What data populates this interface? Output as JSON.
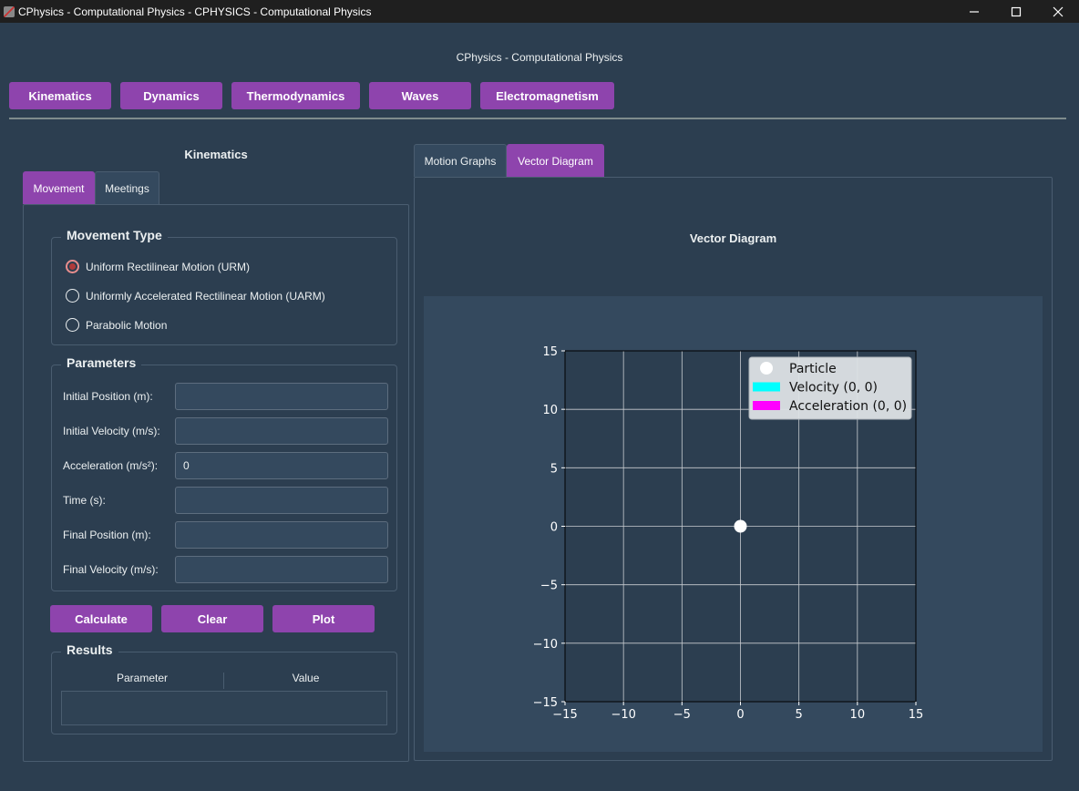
{
  "window": {
    "title": "CPhysics - Computational Physics - CPHYSICS - Computational Physics"
  },
  "app_header": "CPhysics - Computational Physics",
  "nav": [
    "Kinematics",
    "Dynamics",
    "Thermodynamics",
    "Waves",
    "Electromagnetism"
  ],
  "left_panel": {
    "title": "Kinematics",
    "tabs": [
      "Movement",
      "Meetings"
    ],
    "active_tab": "Movement",
    "movement_type": {
      "title": "Movement Type",
      "options": [
        "Uniform Rectilinear Motion (URM)",
        "Uniformly Accelerated Rectilinear Motion (UARM)",
        "Parabolic Motion"
      ],
      "selected": "Uniform Rectilinear Motion (URM)"
    },
    "parameters": {
      "title": "Parameters",
      "fields": [
        {
          "label": "Initial Position (m):",
          "value": ""
        },
        {
          "label": "Initial Velocity (m/s):",
          "value": ""
        },
        {
          "label": "Acceleration (m/s²):",
          "value": "0"
        },
        {
          "label": "Time (s):",
          "value": ""
        },
        {
          "label": "Final Position (m):",
          "value": ""
        },
        {
          "label": "Final Velocity (m/s):",
          "value": ""
        }
      ]
    },
    "buttons": [
      "Calculate",
      "Clear",
      "Plot"
    ],
    "results": {
      "title": "Results",
      "columns": [
        "Parameter",
        "Value"
      ]
    }
  },
  "right_panel": {
    "tabs": [
      "Motion Graphs",
      "Vector Diagram"
    ],
    "active_tab": "Vector Diagram",
    "plot_title": "Vector Diagram"
  },
  "colors": {
    "accent": "#8e44ad",
    "background": "#2c3e50",
    "axes_face": "#2c3e50",
    "figure_face": "#34495e",
    "velocity": "#00ffff",
    "acceleration": "#ff00ff",
    "particle": "#ffffff"
  },
  "chart_data": {
    "type": "scatter",
    "title": "",
    "xlabel": "",
    "ylabel": "",
    "xlim": [
      -15,
      15
    ],
    "ylim": [
      -15,
      15
    ],
    "xticks": [
      -15,
      -10,
      -5,
      0,
      5,
      10,
      15
    ],
    "yticks": [
      -15,
      -10,
      -5,
      0,
      5,
      10,
      15
    ],
    "tick_labels": [
      "−15",
      "−10",
      "−5",
      "0",
      "5",
      "10",
      "15"
    ],
    "grid": true,
    "legend_position": "top-right",
    "series": [
      {
        "name": "Particle",
        "kind": "point",
        "x": [
          0
        ],
        "y": [
          0
        ],
        "color": "#ffffff"
      },
      {
        "name": "Velocity (0, 0)",
        "kind": "vector",
        "x": [
          0
        ],
        "y": [
          0
        ],
        "dx": 0,
        "dy": 0,
        "color": "#00ffff"
      },
      {
        "name": "Acceleration (0, 0)",
        "kind": "vector",
        "x": [
          0
        ],
        "y": [
          0
        ],
        "dx": 0,
        "dy": 0,
        "color": "#ff00ff"
      }
    ]
  }
}
